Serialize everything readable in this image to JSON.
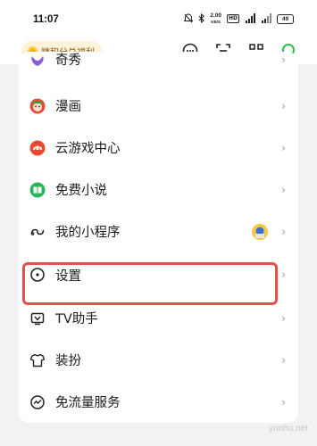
{
  "status_bar": {
    "time": "11:07",
    "net_speed_value": "2.00",
    "net_speed_unit": "KB/S",
    "hd_badge": "HD",
    "battery": "49"
  },
  "topbar": {
    "points_pill_label": "赚积分兑福利",
    "icons": [
      "message-icon",
      "scan-icon",
      "qrcode-icon",
      "search-icon"
    ]
  },
  "menu": {
    "items": [
      {
        "label": "奇秀",
        "icon": "qixiu-icon"
      },
      {
        "label": "漫画",
        "icon": "comic-icon"
      },
      {
        "label": "云游戏中心",
        "icon": "cloud-game-icon"
      },
      {
        "label": "免费小说",
        "icon": "free-novel-icon"
      },
      {
        "label": "我的小程序",
        "icon": "mini-program-icon"
      },
      {
        "label": "设置",
        "icon": "settings-icon"
      },
      {
        "label": "TV助手",
        "icon": "tv-assistant-icon"
      },
      {
        "label": "装扮",
        "icon": "dress-up-icon"
      },
      {
        "label": "免流量服务",
        "icon": "data-free-icon"
      }
    ],
    "chevron": "›"
  },
  "watermark": "yunhu.net",
  "colors": {
    "highlight_border": "#e5504a",
    "accent_green": "#27c24c",
    "points_pill_bg": "#fdf3d9"
  }
}
